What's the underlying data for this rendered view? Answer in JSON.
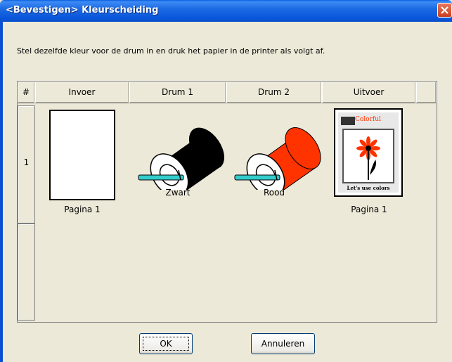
{
  "window": {
    "title": "<Bevestigen> Kleurscheiding"
  },
  "instruction": "Stel dezelfde kleur voor de drum in en druk het papier in de printer als volgt af.",
  "table": {
    "headers": [
      "#",
      "Invoer",
      "Drum 1",
      "Drum 2",
      "Uitvoer",
      ""
    ],
    "rows": [
      {
        "number": "1",
        "input_label": "Pagina 1",
        "drum1_label": "Zwart",
        "drum2_label": "Rood",
        "output_label": "Pagina 1"
      }
    ]
  },
  "output_image": {
    "brand": "Colorful",
    "caption": "Let's use colors"
  },
  "colors": {
    "drum1": "#000000",
    "drum2": "#FF3300",
    "tray": "#33CCCC",
    "title_bar": "#0A5FE0"
  },
  "buttons": {
    "ok": "OK",
    "cancel": "Annuleren"
  }
}
